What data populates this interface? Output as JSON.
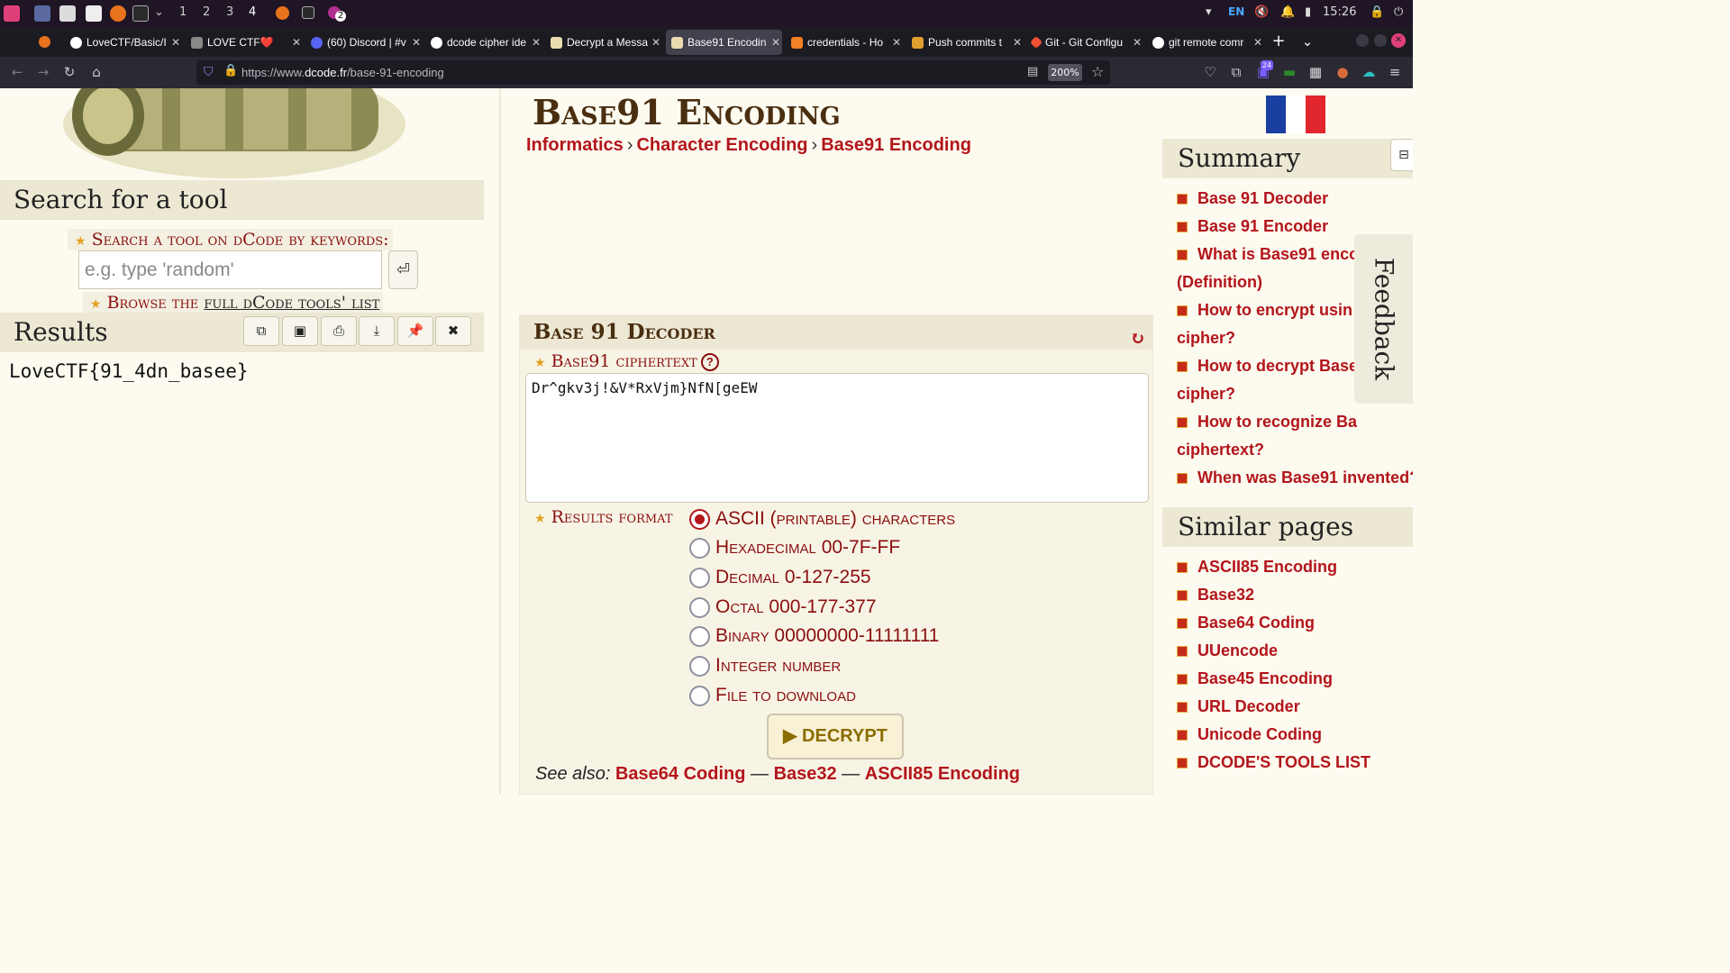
{
  "taskbar": {
    "workspaces": [
      "1",
      "2",
      "3",
      "4"
    ],
    "active_workspace": "4",
    "lang": "EN",
    "time": "15:26",
    "badge": "2"
  },
  "tabs": [
    {
      "title": "LoveCTF/Basic/I",
      "favicon": "github-icon",
      "active": false
    },
    {
      "title": "LOVE CTF❤️",
      "favicon": "ctf-icon",
      "active": false
    },
    {
      "title": "(60) Discord | #v",
      "favicon": "discord-icon",
      "active": false
    },
    {
      "title": "dcode cipher ide",
      "favicon": "google-icon",
      "active": false
    },
    {
      "title": "Decrypt a Messa",
      "favicon": "dcode-icon",
      "active": false
    },
    {
      "title": "Base91 Encodin",
      "favicon": "dcode-icon",
      "active": true
    },
    {
      "title": "credentials - Ho",
      "favicon": "stackoverflow-icon",
      "active": false
    },
    {
      "title": "Push commits t",
      "favicon": "box-icon",
      "active": false
    },
    {
      "title": "Git - Git Configu",
      "favicon": "git-icon",
      "active": false
    },
    {
      "title": "git remote comr",
      "favicon": "google-icon",
      "active": false
    }
  ],
  "nav": {
    "url_prefix": "https://www.",
    "url_domain": "dcode.fr",
    "url_path": "/base-91-encoding",
    "zoom": "200%",
    "ext_badge": "24"
  },
  "left": {
    "search_heading": "Search for a tool",
    "search_label": "Search a tool on dCode by keywords:",
    "search_placeholder": "e.g. type 'random'",
    "browse_prefix": "Browse the ",
    "browse_link": "full dCode tools' list",
    "results_heading": "Results",
    "result_text": "LoveCTF{91_4dn_basee}"
  },
  "center": {
    "title": "Base91 Encoding",
    "breadcrumbs": [
      "Informatics",
      "Character Encoding",
      "Base91 Encoding"
    ],
    "decoder_heading": "Base 91 Decoder",
    "cipher_label": "Base91 ciphertext",
    "cipher_value": "Dr^gkv3j!&V*RxVjm}NfN[geEW",
    "format_label": "Results format",
    "formats": [
      {
        "label": "ASCII (printable) characters",
        "checked": true
      },
      {
        "label": "Hexadecimal 00-7F-FF",
        "checked": false
      },
      {
        "label": "Decimal 0-127-255",
        "checked": false
      },
      {
        "label": "Octal 000-177-377",
        "checked": false
      },
      {
        "label": "Binary 00000000-11111111",
        "checked": false
      },
      {
        "label": "Integer number",
        "checked": false
      },
      {
        "label": "File to download",
        "checked": false
      }
    ],
    "decrypt_label": "▶ DECRYPT",
    "see_also_label": "See also:",
    "see_also_links": [
      "Base64 Coding",
      "Base32",
      "ASCII85 Encoding"
    ],
    "see_also_sep": " — "
  },
  "right": {
    "summary_heading": "Summary",
    "summary_items": [
      "Base 91 Decoder",
      "Base 91 Encoder",
      "What is Base91 enco",
      "(Definition)",
      "How to encrypt usin",
      "cipher?",
      "How to decrypt Base",
      "cipher?",
      "How to recognize Ba",
      "ciphertext?",
      "When was Base91 invented?"
    ],
    "similar_heading": "Similar pages",
    "similar_items": [
      "ASCII85 Encoding",
      "Base32",
      "Base64 Coding",
      "UUencode",
      "Base45 Encoding",
      "URL Decoder",
      "Unicode Coding",
      "DCODE'S TOOLS LIST"
    ],
    "feedback": "Feedback"
  },
  "colors": {
    "accent": "#b3151b",
    "dark_red": "#8b0e0e",
    "title_brown": "#4a2e10",
    "page_bg": "#fdfbf0",
    "panel_head": "#ece8d4"
  }
}
